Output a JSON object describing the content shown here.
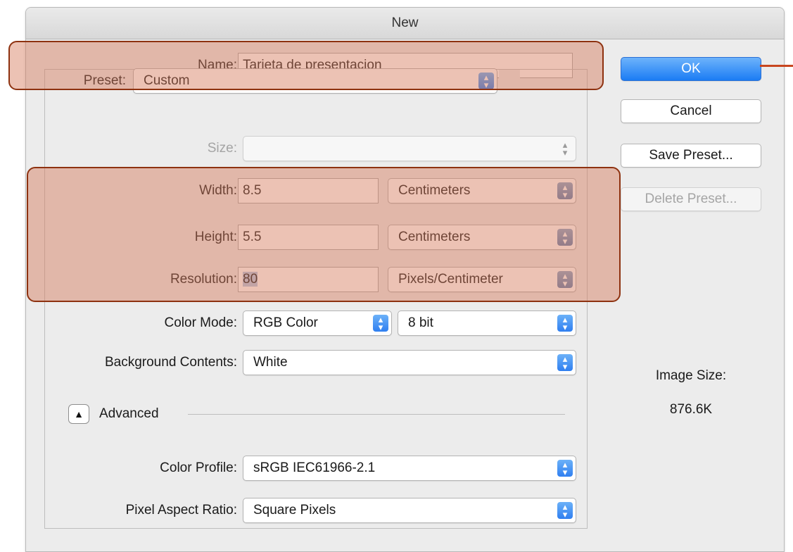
{
  "window": {
    "title": "New"
  },
  "fields": {
    "name": {
      "label": "Name:",
      "value": "Tarjeta de presentacion"
    },
    "preset": {
      "label": "Preset:",
      "value": "Custom"
    },
    "size": {
      "label": "Size:",
      "value": ""
    },
    "width": {
      "label": "Width:",
      "value": "8.5",
      "unit": "Centimeters"
    },
    "height": {
      "label": "Height:",
      "value": "5.5",
      "unit": "Centimeters"
    },
    "resolution": {
      "label": "Resolution:",
      "value": "80",
      "unit": "Pixels/Centimeter"
    },
    "color_mode": {
      "label": "Color Mode:",
      "value": "RGB Color",
      "depth": "8 bit"
    },
    "background": {
      "label": "Background Contents:",
      "value": "White"
    },
    "advanced": {
      "label": "Advanced",
      "icon": "disclosure-triangle-up-icon"
    },
    "color_profile": {
      "label": "Color Profile:",
      "value": "sRGB IEC61966-2.1"
    },
    "pixel_aspect": {
      "label": "Pixel Aspect Ratio:",
      "value": "Square Pixels"
    }
  },
  "buttons": {
    "ok": "OK",
    "cancel": "Cancel",
    "save_preset": "Save Preset...",
    "delete_preset": "Delete Preset..."
  },
  "image_size": {
    "label": "Image Size:",
    "value": "876.6K"
  },
  "colors": {
    "accent": "#2f7ff0",
    "highlight": "#d47858",
    "highlight_border": "#8e3210",
    "pointer": "#c8461f"
  },
  "icons": {
    "popup": "chevron-up-down-icon"
  }
}
